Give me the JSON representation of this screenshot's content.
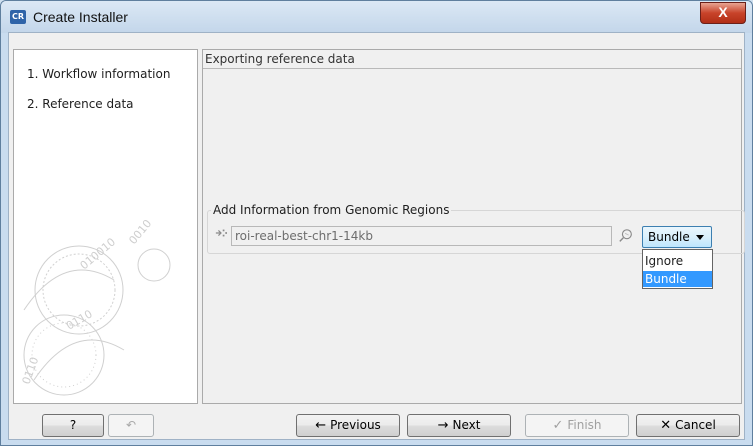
{
  "window": {
    "title": "Create Installer",
    "app_icon_label": "CR",
    "close_label": "X"
  },
  "steps": [
    {
      "label": "1.  Workflow information"
    },
    {
      "label": "2.  Reference data"
    }
  ],
  "section": {
    "title": "Exporting reference data"
  },
  "group": {
    "title": "Add Information from Genomic Regions",
    "field_value": "roi-real-best-chr1-14kb",
    "dropdown_value": "Bundle",
    "options": [
      {
        "label": "Ignore",
        "selected": false
      },
      {
        "label": "Bundle",
        "selected": true
      }
    ]
  },
  "buttons": {
    "help": "?",
    "previous": "Previous",
    "next": "Next",
    "finish": "Finish",
    "cancel": "Cancel"
  },
  "colors": {
    "accent": "#3399ff",
    "close": "#c8432a"
  }
}
